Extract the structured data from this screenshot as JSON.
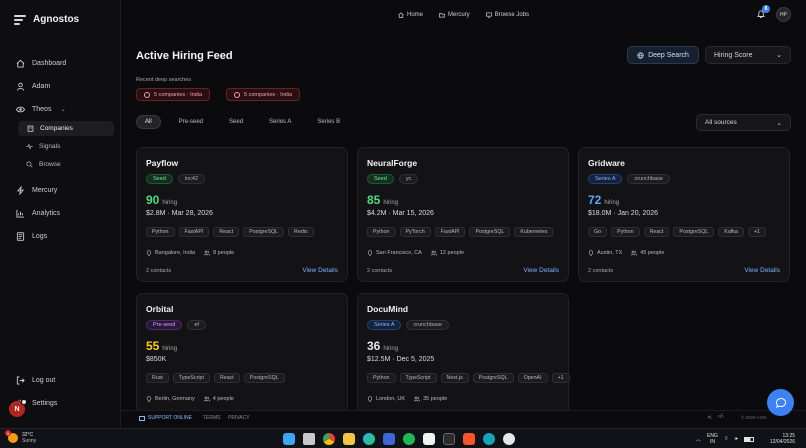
{
  "app": {
    "name": "Agnostos"
  },
  "sidebar": {
    "items": [
      {
        "label": "Dashboard",
        "icon": "home-icon"
      },
      {
        "label": "Adam",
        "icon": "user-icon"
      },
      {
        "label": "Theos",
        "icon": "eye-icon"
      }
    ],
    "theos_sub": [
      {
        "label": "Companies",
        "icon": "building-icon"
      },
      {
        "label": "Signals",
        "icon": "signal-icon"
      },
      {
        "label": "Browse",
        "icon": "search-icon"
      }
    ],
    "items2": [
      {
        "label": "Mercury",
        "icon": "lightning-icon"
      },
      {
        "label": "Analytics",
        "icon": "chart-icon"
      },
      {
        "label": "Logs",
        "icon": "logs-icon"
      }
    ],
    "logout": "Log out",
    "settings": "Settings",
    "avatar_letter": "N"
  },
  "topnav": {
    "home": "Home",
    "mercury": "Mercury",
    "browse_jobs": "Browse Jobs"
  },
  "notifications": {
    "count": "8"
  },
  "user": {
    "initials": "HP"
  },
  "header": {
    "title": "Active Hiring Feed",
    "deep_search": "Deep Search",
    "sort": "Hiring Score",
    "recent_label": "Recent deep searches",
    "recent": [
      "5 companies · India",
      "5 companies · India"
    ]
  },
  "filters": {
    "tabs": [
      "All",
      "Pre-seed",
      "Seed",
      "Series A",
      "Series B"
    ],
    "source": "All sources"
  },
  "cards": [
    {
      "name": "Payflow",
      "stage": "Seed",
      "source": "inc42",
      "hiring": "90",
      "hiring_label": "hiring",
      "funding": "$2.8M · Mar 28, 2026",
      "tags": [
        "Python",
        "FastAPI",
        "React",
        "PostgreSQL",
        "Redis"
      ],
      "location": "Bangalore, India",
      "people": "8 people",
      "contacts": "2 contacts",
      "view": "View Details"
    },
    {
      "name": "NeuralForge",
      "stage": "Seed",
      "source": "yc",
      "hiring": "85",
      "hiring_label": "hiring",
      "funding": "$4.2M · Mar 15, 2026",
      "tags": [
        "Python",
        "PyTorch",
        "FastAPI",
        "PostgreSQL",
        "Kubernetes"
      ],
      "location": "San Francisco, CA",
      "people": "12 people",
      "contacts": "2 contacts",
      "view": "View Details"
    },
    {
      "name": "Gridware",
      "stage": "Series A",
      "source": "crunchbase",
      "hiring": "72",
      "hiring_label": "hiring",
      "funding": "$18.0M · Jan 20, 2026",
      "tags": [
        "Go",
        "Python",
        "React",
        "PostgreSQL",
        "Kafka",
        "+1"
      ],
      "location": "Austin, TX",
      "people": "45 people",
      "contacts": "2 contacts",
      "view": "View Details"
    },
    {
      "name": "Orbital",
      "stage": "Pre-seed",
      "source": "ef",
      "hiring": "55",
      "hiring_label": "hiring",
      "funding": "$850K",
      "tags": [
        "Rust",
        "TypeScript",
        "React",
        "PostgreSQL"
      ],
      "location": "Berlin, Germany",
      "people": "4 people",
      "contacts": "",
      "view": ""
    },
    {
      "name": "DocuMind",
      "stage": "Series A",
      "source": "crunchbase",
      "hiring": "36",
      "hiring_label": "hiring",
      "funding": "$12.5M · Dec 5, 2025",
      "tags": [
        "Python",
        "TypeScript",
        "Next.js",
        "PostgreSQL",
        "OpenAI",
        "+1"
      ],
      "location": "London, UK",
      "people": "35 people",
      "contacts": "",
      "view": ""
    }
  ],
  "colors": {
    "score_green": "#4ade80",
    "score_blue": "#60a5fa",
    "score_yellow": "#facc15",
    "score_white": "#e5e5e5",
    "accent": "#3b82f6"
  },
  "footer": {
    "support": "SUPPORT ONLINE",
    "terms": "TERMS",
    "privacy": "PRIVACY",
    "copyright": "© 2026 AGN"
  },
  "taskbar": {
    "temp": "32°C",
    "weather": "Sunny",
    "weather_badge": "1",
    "lang1": "ENG",
    "lang2": "IN",
    "time": "13:25",
    "date": "12/04/2026"
  }
}
